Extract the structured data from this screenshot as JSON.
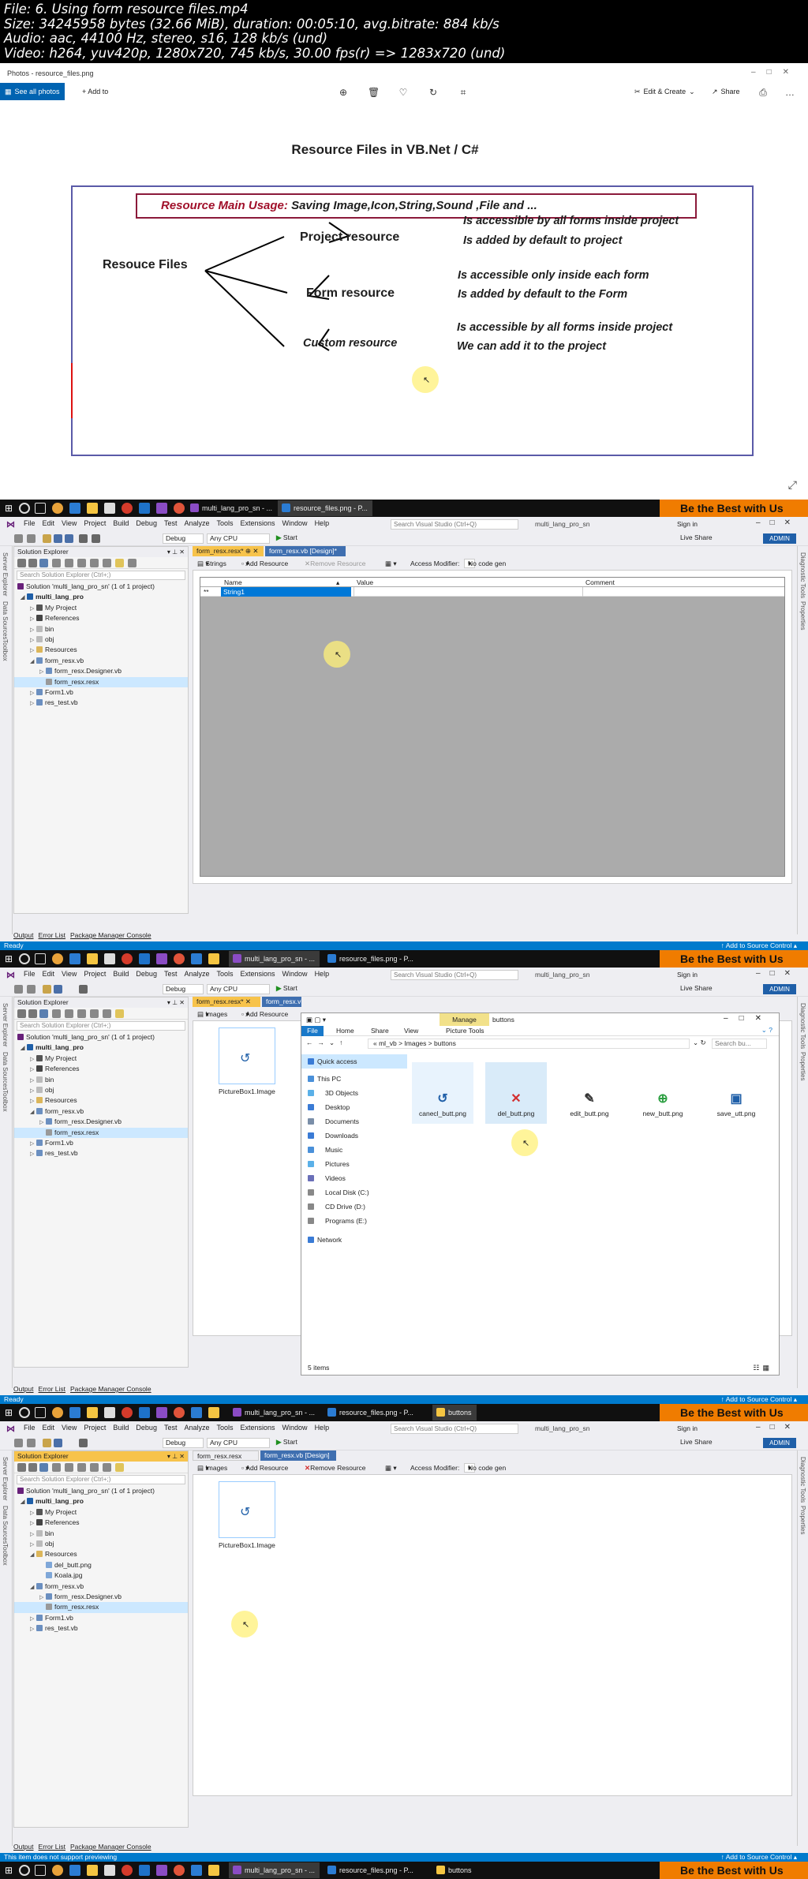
{
  "video_info": {
    "line1": "File: 6. Using form resource files.mp4",
    "line2": "Size: 34245958 bytes (32.66 MiB), duration: 00:05:10, avg.bitrate: 884 kb/s",
    "line3": "Audio: aac, 44100 Hz, stereo, s16, 128 kb/s (und)",
    "line4": "Video: h264, yuv420p, 1280x720, 745 kb/s, 30.00 fps(r) => 1283x720 (und)"
  },
  "photos": {
    "title": "Photos - resource_files.png",
    "see_all": "See all photos",
    "add_to": "+ Add to",
    "edit_create": "Edit & Create",
    "share": "Share",
    "heading": "Resource Files in VB.Net / C#",
    "usage_label": "Resource Main Usage:",
    "usage_text": "Saving Image,Icon,String,Sound ,File and ...",
    "root": "Resouce Files",
    "project_resource": "Project resource",
    "form_resource": "Form resource",
    "custom_resource": "Custom resource",
    "pr1": "Is accessible by all forms inside project",
    "pr2": "Is added by default to project",
    "fr1": "Is accessible only inside each form",
    "fr2": "Is added by default to the Form",
    "cr1": "Is accessible by all forms inside project",
    "cr2": "We can add it to the project"
  },
  "taskbar": {
    "app1": "multi_lang_pro_sn - ...",
    "app2": "resource_files.png - P...",
    "app3": "buttons",
    "banner": "Be the Best with Us"
  },
  "vs": {
    "menu": [
      "File",
      "Edit",
      "View",
      "Project",
      "Build",
      "Debug",
      "Test",
      "Analyze",
      "Tools",
      "Extensions",
      "Window",
      "Help"
    ],
    "search": "Search Visual Studio (Ctrl+Q)",
    "project_name": "multi_lang_pro_sn",
    "sign_in": "Sign in",
    "debug": "Debug",
    "cpu": "Any CPU",
    "start": "Start",
    "live_share": "Live Share",
    "admin": "ADMIN",
    "left_strip": [
      "Server Explorer",
      "Data Sources",
      "Toolbox"
    ],
    "right_strip": [
      "Diagnostic Tools",
      "Properties"
    ],
    "solution_explorer": "Solution Explorer",
    "se_search": "Search Solution Explorer (Ctrl+;)",
    "tree1": [
      "Solution 'multi_lang_pro_sn' (1 of 1 project)",
      "multi_lang_pro",
      "My Project",
      "References",
      "bin",
      "obj",
      "Resources",
      "form_resx.vb",
      "form_resx.Designer.vb",
      "form_resx.resx",
      "Form1.vb",
      "res_test.vb"
    ],
    "tree3": [
      "Solution 'multi_lang_pro_sn' (1 of 1 project)",
      "multi_lang_pro",
      "My Project",
      "References",
      "bin",
      "obj",
      "Resources",
      "del_butt.png",
      "Koala.jpg",
      "form_resx.vb",
      "form_resx.Designer.vb",
      "form_resx.resx",
      "Form1.vb",
      "res_test.vb"
    ],
    "tab_resx_mod": "form_resx.resx*",
    "tab_resx": "form_resx.resx",
    "tab_design_mod": "form_resx.vb [Design]*",
    "tab_design": "form_resx.vb [Design]",
    "strings": "Strings",
    "images": "Images",
    "add_resource": "Add Resource",
    "remove_resource": "Remove Resource",
    "access_modifier": "Access Modifier:",
    "no_code_gen": "No code gen",
    "col_name": "Name",
    "col_value": "Value",
    "col_comment": "Comment",
    "row_marker": "**",
    "row_name": "String1",
    "picturebox": "PictureBox1.Image",
    "output_tabs": [
      "Output",
      "Error List",
      "Package Manager Console"
    ],
    "status_ready": "Ready",
    "status_preview": "This item does not support previewing",
    "source_control": "Add to Source Control"
  },
  "explorer": {
    "title": "buttons",
    "manage": "Manage",
    "picture_tools": "Picture Tools",
    "ribbon_tabs": [
      "File",
      "Home",
      "Share",
      "View"
    ],
    "path": "« ml_vb > Images > buttons",
    "search": "Search bu...",
    "nav": [
      "Quick access",
      "This PC",
      "3D Objects",
      "Desktop",
      "Documents",
      "Downloads",
      "Music",
      "Pictures",
      "Videos",
      "Local Disk (C:)",
      "CD Drive (D:)",
      "Programs (E:)",
      "Network"
    ],
    "files": [
      "canecl_butt.png",
      "del_butt.png",
      "edit_butt.png",
      "new_butt.png",
      "save_utt.png"
    ],
    "items": "5 items"
  },
  "colors": {
    "accent": "#007acc",
    "banner": "#f07c00",
    "tab_active": "#f7c34b",
    "usage_red": "#a0102a"
  },
  "icons": [
    "windows-start-icon",
    "search-icon",
    "undo-icon",
    "redo-icon",
    "save-icon",
    "play-icon",
    "folder-icon",
    "file-icon",
    "image-icon",
    "cursor-icon"
  ]
}
